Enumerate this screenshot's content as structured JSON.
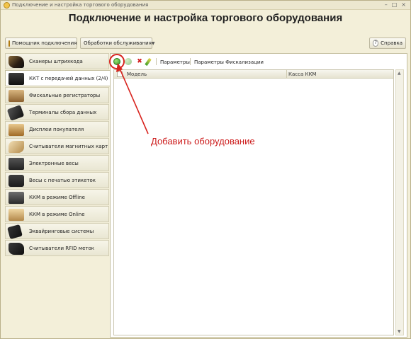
{
  "window": {
    "title": "Подключение и настройка торгового оборудования"
  },
  "page": {
    "title": "Подключение и настройка торгового оборудования"
  },
  "toolbar": {
    "assistant_label": "Помощник подключения",
    "service_label": "Обработки обслуживания",
    "help_label": "Справка"
  },
  "sidebar": {
    "items": [
      {
        "label": "Сканеры штрихкода",
        "icon": "barcode-scanner-icon"
      },
      {
        "label": "ККТ с передачей данных (2/4)",
        "icon": "kkt-icon",
        "active": true
      },
      {
        "label": "Фискальные регистраторы",
        "icon": "fiscal-register-icon"
      },
      {
        "label": "Терминалы сбора данных",
        "icon": "data-terminal-icon"
      },
      {
        "label": "Дисплеи покупателя",
        "icon": "customer-display-icon"
      },
      {
        "label": "Считыватели магнитных карт",
        "icon": "magnetic-card-reader-icon"
      },
      {
        "label": "Электронные весы",
        "icon": "electronic-scales-icon"
      },
      {
        "label": "Весы с печатью этикеток",
        "icon": "label-scales-icon"
      },
      {
        "label": "ККМ в режиме Offline",
        "icon": "kkm-offline-icon"
      },
      {
        "label": "ККМ в режиме Online",
        "icon": "kkm-online-icon"
      },
      {
        "label": "Эквайринговые системы",
        "icon": "acquiring-icon"
      },
      {
        "label": "Считыватели RFID меток",
        "icon": "rfid-reader-icon"
      }
    ]
  },
  "grid_toolbar": {
    "params_label": "Параметры",
    "fiscal_params_label": "Параметры Фискализации"
  },
  "table": {
    "columns": [
      "Модель",
      "Касса ККМ"
    ],
    "rows": []
  },
  "annotation": {
    "text": "Добавить оборудование",
    "color": "#cc1b1b"
  }
}
